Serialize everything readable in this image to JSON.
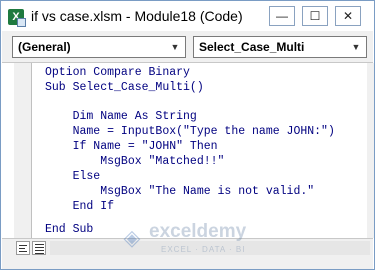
{
  "window": {
    "title": "if vs case.xlsm - Module18 (Code)",
    "minimize_glyph": "—",
    "maximize_glyph": "☐",
    "close_glyph": "✕",
    "app_icon": "excel-icon",
    "app_icon_glyph": "X"
  },
  "toolbar": {
    "object_combo": "(General)",
    "procedure_combo": "Select_Case_Multi",
    "dropdown_glyph": "▼"
  },
  "code": {
    "lines": [
      "Option Compare Binary",
      "Sub Select_Case_Multi()",
      "",
      "    Dim Name As String",
      "    Name = InputBox(\"Type the name JOHN:\")",
      "    If Name = \"JOHN\" Then",
      "        MsgBox \"Matched!!\"",
      "    Else",
      "        MsgBox \"The Name is not valid.\"",
      "    End If",
      "",
      "End Sub"
    ]
  },
  "statusbar": {
    "procedure_view_icon": "procedure-view-icon",
    "full_module_view_icon": "full-module-view-icon"
  },
  "watermark": {
    "name": "exceldemy",
    "tagline": "EXCEL · DATA · BI",
    "icon": "exceldemy-logo-icon",
    "icon_glyph": "◈"
  },
  "colors": {
    "keyword": "#000080",
    "text": "#000000",
    "border": "#7a9cc4"
  }
}
